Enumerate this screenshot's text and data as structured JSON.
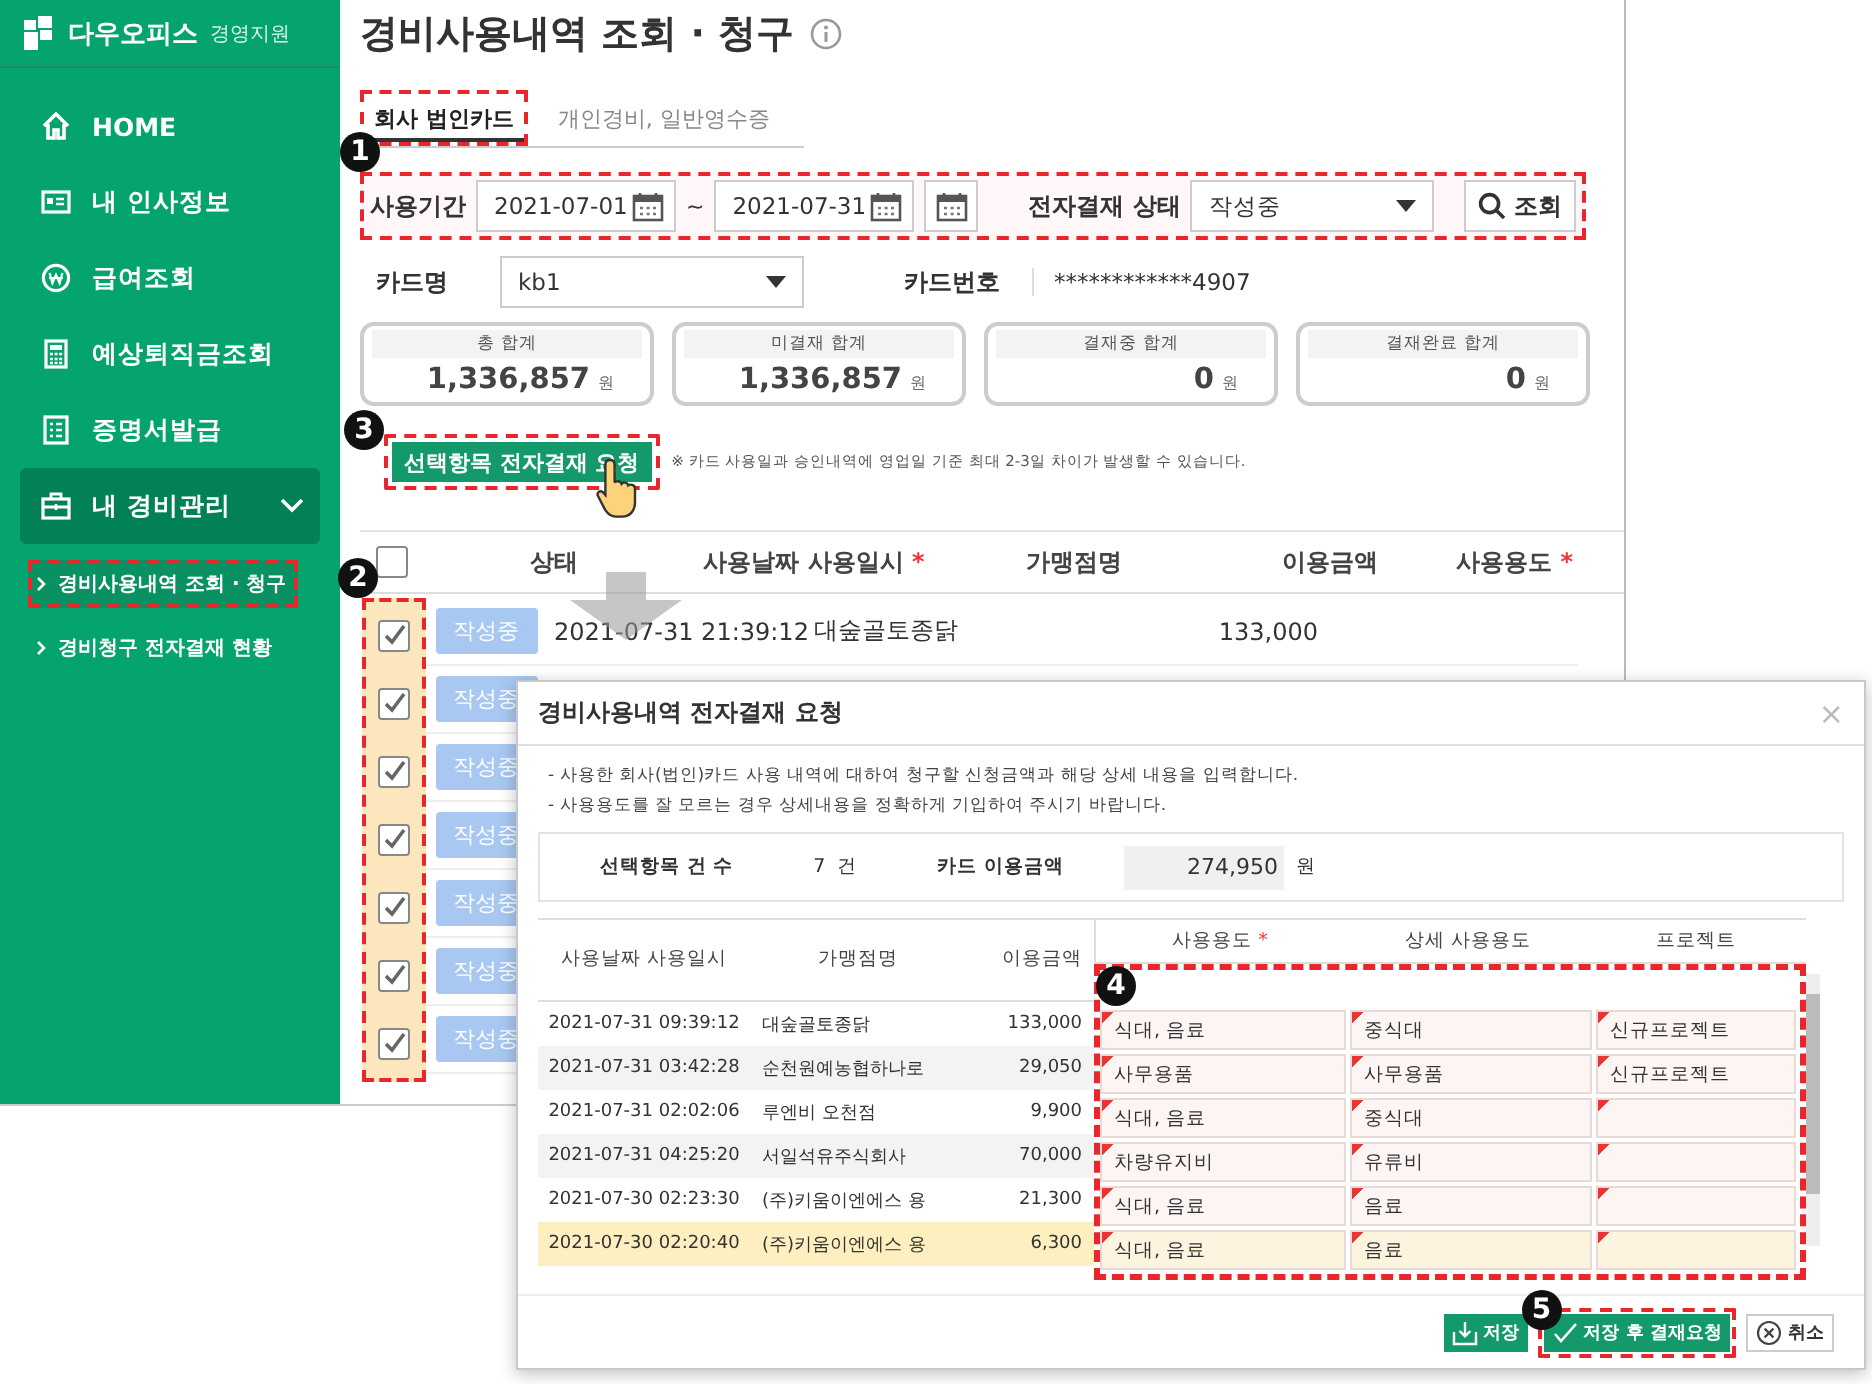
{
  "sidebar": {
    "brand": "다우오피스",
    "brand_sub": "경영지원",
    "items": [
      {
        "kind": "link",
        "label": "HOME",
        "selected": false
      },
      {
        "kind": "link",
        "label": "내 인사정보",
        "selected": false
      },
      {
        "kind": "link",
        "label": "급여조회",
        "selected": false
      },
      {
        "kind": "link",
        "label": "예상퇴직금조회",
        "selected": false
      },
      {
        "kind": "link",
        "label": "증명서발급",
        "selected": false
      },
      {
        "kind": "group",
        "label": "내 경비관리",
        "selected": true,
        "expanded": true,
        "children": [
          {
            "label": "경비사용내역 조회 · 청구",
            "selected": true,
            "highlighted": true
          },
          {
            "label": "경비청구 전자결재 현황",
            "selected": false,
            "highlighted": false
          }
        ]
      }
    ]
  },
  "page": {
    "title": "경비사용내역 조회 · 청구",
    "tabs": [
      {
        "label": "회사 법인카드",
        "selected": true,
        "highlighted": true
      },
      {
        "label": "개인경비, 일반영수증",
        "selected": false,
        "highlighted": false
      }
    ],
    "filter": {
      "marker": "1",
      "highlighted": true,
      "period_label": "사용기간",
      "date_from": "2021-07-01",
      "separator": "~",
      "date_to": "2021-07-31",
      "status_label": "전자결재 상태",
      "status_value": "작성중",
      "search_button": "조회"
    },
    "card": {
      "name_label": "카드명",
      "name_value": "kb1",
      "number_label": "카드번호",
      "number_value": "************4907"
    },
    "totals": [
      {
        "label": "총 합계",
        "amount": "1,336,857",
        "unit": "원"
      },
      {
        "label": "미결재 합계",
        "amount": "1,336,857",
        "unit": "원"
      },
      {
        "label": "결재중 합계",
        "amount": "0",
        "unit": "원"
      },
      {
        "label": "결재완료 합계",
        "amount": "0",
        "unit": "원"
      }
    ],
    "request_button": {
      "label": "선택항목 전자결재 요청",
      "marker": "3",
      "highlighted": true
    },
    "note": "※ 카드 사용일과 승인내역에 영업일 기준 최대 2-3일 차이가 발생할 수 있습니다.",
    "table": {
      "all_checked": false,
      "marker": "2",
      "highlighted": true,
      "columns": [
        {
          "label": "상태"
        },
        {
          "label": "사용날짜 사용일시",
          "required_mark": "*"
        },
        {
          "label": "가맹점명"
        },
        {
          "label": "이용금액"
        },
        {
          "label": "사용용도",
          "required_mark": "*"
        }
      ],
      "rows": [
        {
          "checked": true,
          "status": "작성중",
          "date": "2021-07-31 21:39:12",
          "merchant": "대숲골토종닭",
          "amount": "133,000"
        },
        {
          "checked": true,
          "status": "작성중"
        },
        {
          "checked": true,
          "status": "작성중"
        },
        {
          "checked": true,
          "status": "작성중"
        },
        {
          "checked": true,
          "status": "작성중"
        },
        {
          "checked": true,
          "status": "작성중"
        },
        {
          "checked": true,
          "status": "작성중"
        }
      ]
    }
  },
  "modal": {
    "title": "경비사용내역 전자결재 요청",
    "close": "×",
    "notes": [
      "- 사용한 회사(법인)카드 사용 내역에 대하여 청구할 신청금액과 해당 상세 내용을 입력합니다.",
      "- 사용용도를 잘 모르는 경우 상세내용을 정확하게 기입하여 주시기 바랍니다."
    ],
    "summary": {
      "count_label": "선택항목 건 수",
      "count": "7",
      "count_unit": "건",
      "amount_label": "카드 이용금액",
      "amount": "274,950",
      "amount_unit": "원"
    },
    "columns": [
      {
        "label": "사용날짜 사용일시"
      },
      {
        "label": "가맹점명"
      },
      {
        "label": "이용금액"
      },
      {
        "label": "사용용도",
        "required_mark": "*"
      },
      {
        "label": "상세 사용용도"
      },
      {
        "label": "프로젝트"
      }
    ],
    "marker": "4",
    "highlighted": true,
    "rows": [
      {
        "date": "2021-07-31 09:39:12",
        "merchant": "대숲골토종닭",
        "amount": "133,000",
        "purpose": "식대, 음료",
        "detail": "중식대",
        "project": "신규프로젝트",
        "selected": false
      },
      {
        "date": "2021-07-31 03:42:28",
        "merchant": "순천원예농협하나로",
        "amount": "29,050",
        "purpose": "사무용품",
        "detail": "사무용품",
        "project": "신규프로젝트",
        "selected": false
      },
      {
        "date": "2021-07-31 02:02:06",
        "merchant": "루엔비 오천점",
        "amount": "9,900",
        "purpose": "식대, 음료",
        "detail": "중식대",
        "selected": false
      },
      {
        "date": "2021-07-31 04:25:20",
        "merchant": "서일석유주식회사",
        "amount": "70,000",
        "purpose": "차량유지비",
        "detail": "유류비",
        "selected": false
      },
      {
        "date": "2021-07-30 02:23:30",
        "merchant": "(주)키움이엔에스 용",
        "amount": "21,300",
        "purpose": "식대, 음료",
        "detail": "음료",
        "selected": false
      },
      {
        "date": "2021-07-30 02:20:40",
        "merchant": "(주)키움이엔에스 용",
        "amount": "6,300",
        "purpose": "식대, 음료",
        "detail": "음료",
        "selected": true
      }
    ],
    "buttons": [
      {
        "kind": "save",
        "label": "저장",
        "highlighted": false
      },
      {
        "kind": "approve",
        "label": "저장 후 결재요청",
        "highlighted": true,
        "marker": "5"
      },
      {
        "kind": "cancel",
        "label": "취소",
        "highlighted": false
      }
    ]
  }
}
